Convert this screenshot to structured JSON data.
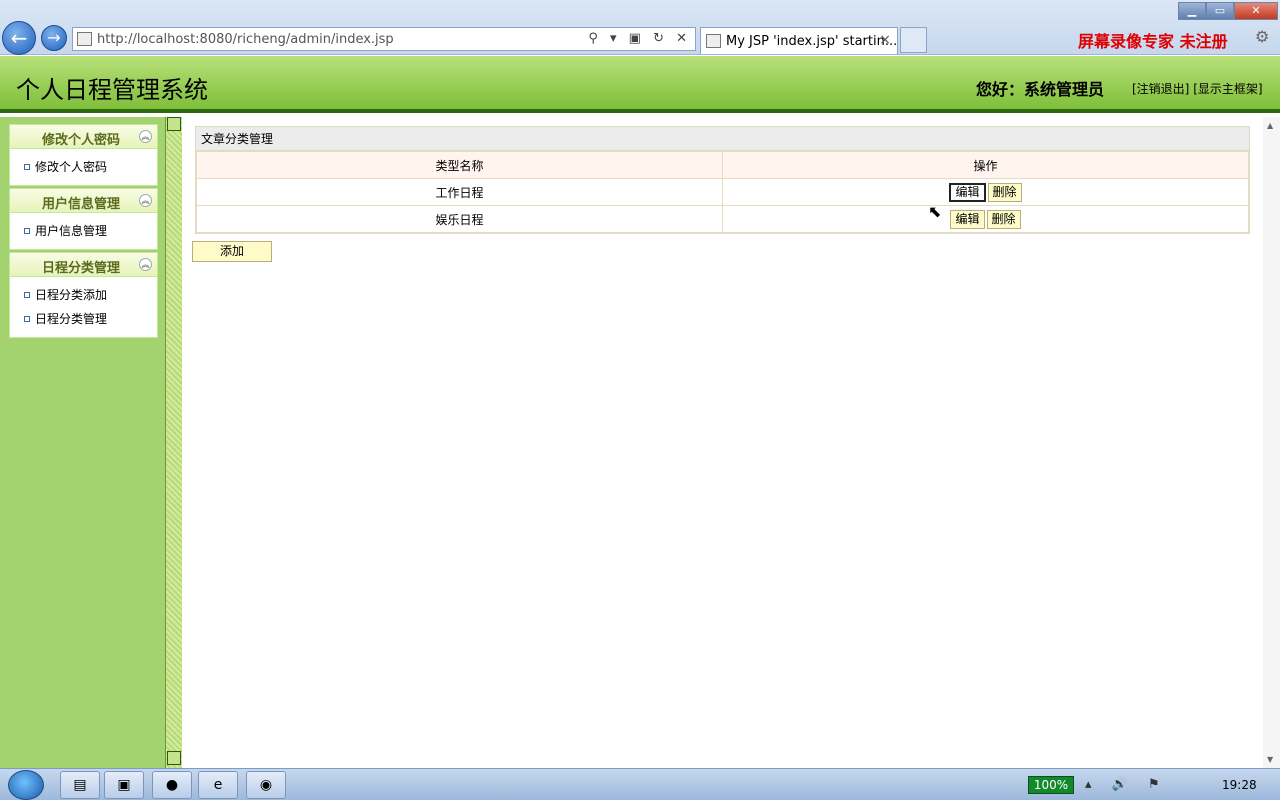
{
  "browser": {
    "url": "http://localhost:8080/richeng/admin/index.jsp",
    "tab_title": "My JSP 'index.jsp' startin...",
    "tab_close": "×",
    "address_tools": "⚲ ▾ ▣ ↻ ✕",
    "watermark": "屏幕录像专家  未注册",
    "win_min": "▁",
    "win_max": "▭",
    "win_close": "✕"
  },
  "header": {
    "title": "个人日程管理系统",
    "greeting": "您好：系统管理员",
    "logout": "[注销退出]",
    "show_main_frame": "[显示主框架]"
  },
  "sidebar": {
    "groups": [
      {
        "title": "修改个人密码",
        "items": [
          "修改个人密码"
        ]
      },
      {
        "title": "用户信息管理",
        "items": [
          "用户信息管理"
        ]
      },
      {
        "title": "日程分类管理",
        "items": [
          "日程分类添加",
          "日程分类管理"
        ]
      }
    ],
    "collapse_glyph": "︽"
  },
  "main": {
    "panel_title": "文章分类管理",
    "columns": [
      "类型名称",
      "操作"
    ],
    "rows": [
      {
        "name": "工作日程",
        "edit": "编辑",
        "delete": "删除"
      },
      {
        "name": "娱乐日程",
        "edit": "编辑",
        "delete": "删除"
      }
    ],
    "add_label": "添加"
  },
  "taskbar": {
    "battery": "100%",
    "clock": "19:28",
    "tray_icons": "▴ 🔊 ⚑"
  },
  "icons": {
    "back": "back-arrow-icon",
    "forward": "forward-arrow-icon",
    "page": "page-icon",
    "gear": "gear-icon"
  }
}
